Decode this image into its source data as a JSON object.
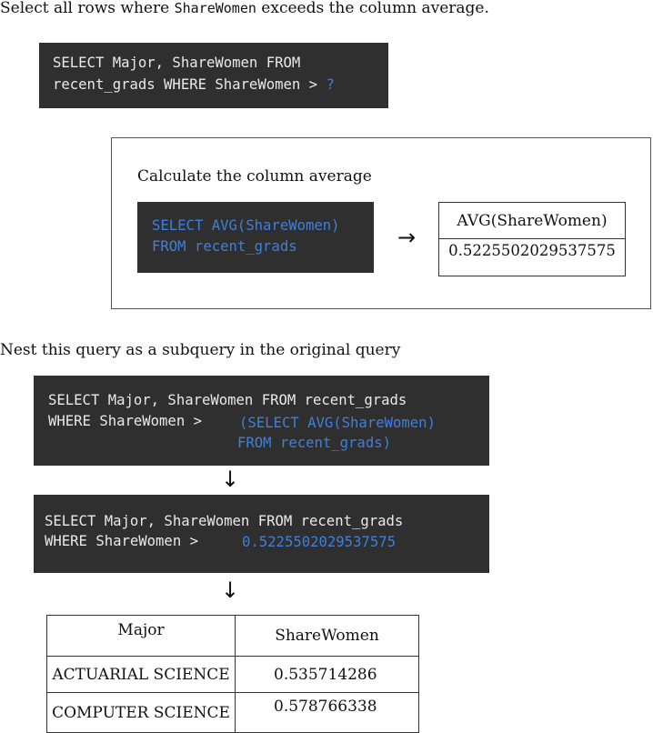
{
  "intro": {
    "prefix": "Select all rows where ",
    "code": "ShareWomen",
    "suffix": " exceeds the column average."
  },
  "query1": {
    "line1": "SELECT Major, ShareWomen FROM",
    "line2": "recent_grads WHERE ShareWomen > ",
    "placeholder": "?"
  },
  "avg_panel": {
    "title": "Calculate the column average",
    "code_line1": "SELECT AVG(ShareWomen)",
    "code_line2": "FROM recent_grads",
    "arrow": "→",
    "result_header": "AVG(ShareWomen)",
    "result_value": "0.5225502029537575"
  },
  "nest_text": "Nest this query as a subquery in the original query",
  "query2": {
    "line1": "SELECT Major, ShareWomen FROM recent_grads",
    "line2": "WHERE ShareWomen > ",
    "sub1": "(SELECT AVG(ShareWomen)",
    "sub2": "FROM recent_grads)"
  },
  "arrow_down": "↓",
  "query3": {
    "line1": "SELECT Major, ShareWomen FROM recent_grads",
    "line2": "WHERE ShareWomen > ",
    "value": "0.5225502029537575"
  },
  "result_table": {
    "headers": [
      "Major",
      "ShareWomen"
    ],
    "rows": [
      [
        "ACTUARIAL SCIENCE",
        "0.535714286"
      ],
      [
        "COMPUTER SCIENCE",
        "0.578766338"
      ]
    ]
  }
}
